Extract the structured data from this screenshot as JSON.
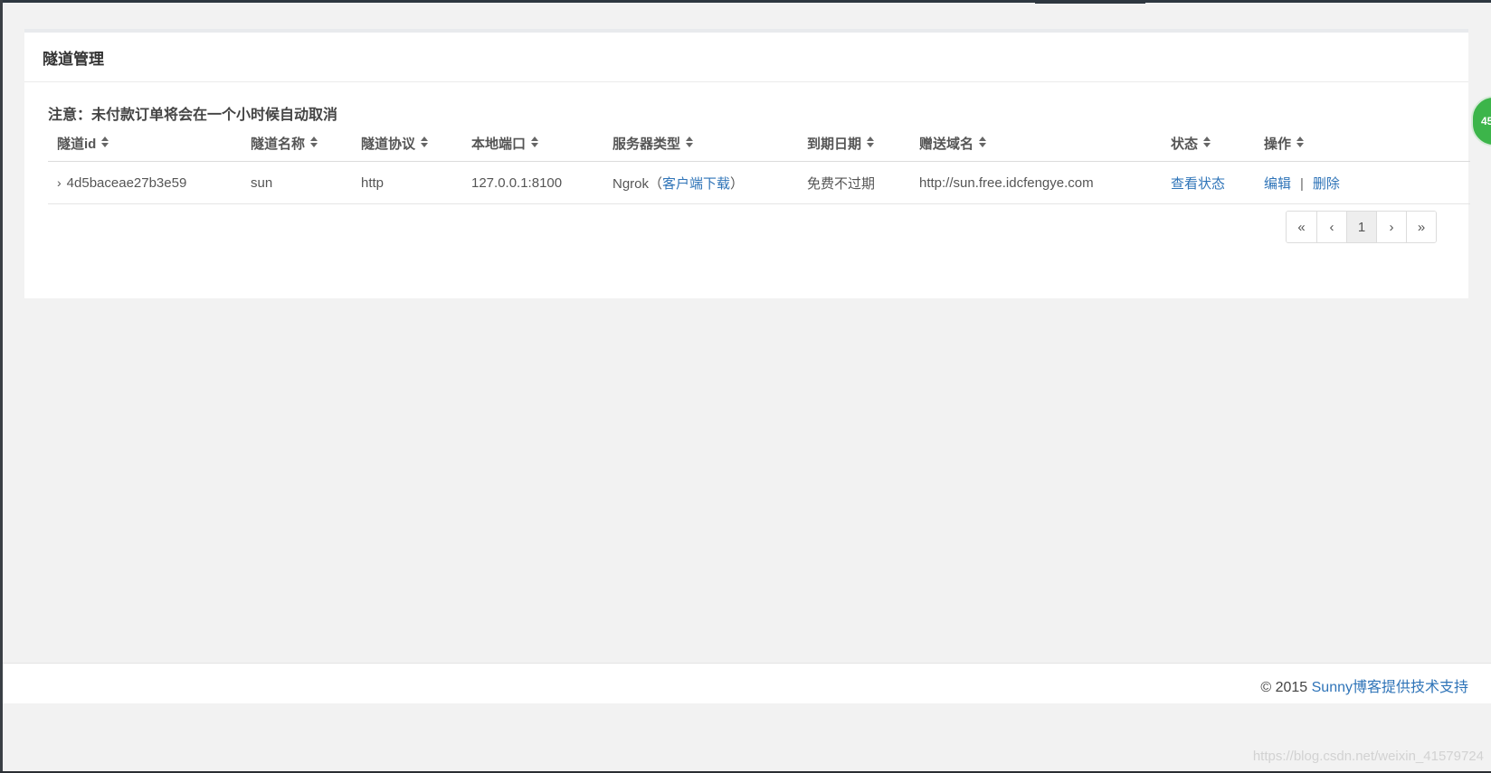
{
  "panel": {
    "title": "隧道管理",
    "notice": "注意：未付款订单将会在一个小时候自动取消"
  },
  "table": {
    "headers": [
      "隧道id",
      "隧道名称",
      "隧道协议",
      "本地端口",
      "服务器类型",
      "到期日期",
      "赠送域名",
      "状态",
      "操作"
    ],
    "rows": [
      {
        "id": "4d5baceae27b3e59",
        "name": "sun",
        "protocol": "http",
        "local_port": "127.0.0.1:8100",
        "server_type": "Ngrok",
        "client_download_open": "（",
        "client_download": "客户端下载",
        "client_download_close": "）",
        "expiry": "免费不过期",
        "domain": "http://sun.free.idcfengye.com",
        "status_link": "查看状态",
        "edit": "编辑",
        "separator": "|",
        "delete": "删除"
      }
    ]
  },
  "pagination": {
    "first": "«",
    "prev": "‹",
    "current": "1",
    "next": "›",
    "last": "»"
  },
  "badge": "45",
  "footer": {
    "copyright": "© 2015 ",
    "link": "Sunny博客提供技术支持"
  },
  "watermark": "https://blog.csdn.net/weixin_41579724",
  "colors": {
    "link": "#2f74b8",
    "badge": "#3cb54a",
    "background": "#f2f2f2"
  },
  "icons": {
    "sort": "sort-icon",
    "expand": "chevron-right-icon"
  }
}
